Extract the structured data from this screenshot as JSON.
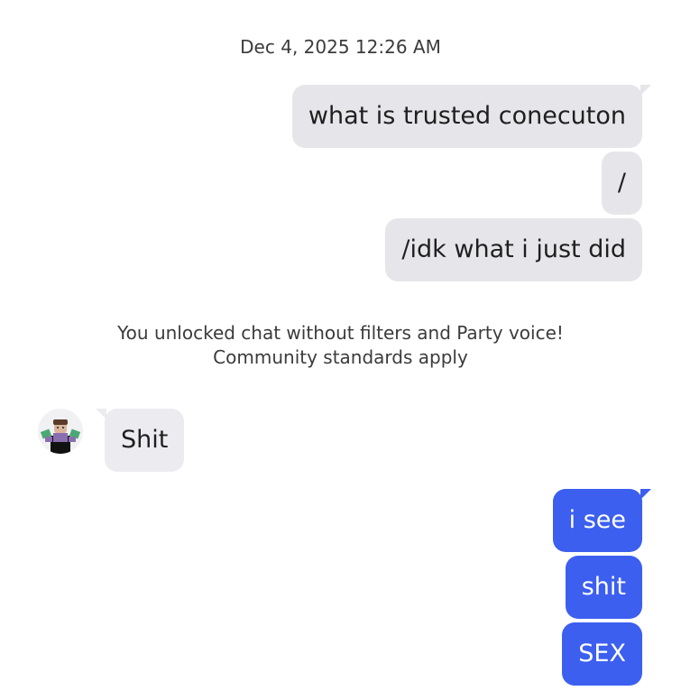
{
  "timestamp": "Dec 4, 2025 12:26 AM",
  "messages_before": [
    {
      "text": "what is trusted conecuton"
    },
    {
      "text": "/"
    },
    {
      "text": "/idk what i just did"
    }
  ],
  "system_notice": {
    "line1": "You unlocked chat without filters and Party voice!",
    "line2": "Community standards apply"
  },
  "incoming": {
    "text": "Shit",
    "avatar_icon": "roblox-avatar-icon"
  },
  "messages_after": [
    {
      "text": "i see"
    },
    {
      "text": "shit"
    },
    {
      "text": "SEX"
    }
  ],
  "colors": {
    "outgoing_grey": "#e6e6ea",
    "outgoing_blue": "#3c5ff0",
    "incoming_grey": "#ececf0",
    "meta_text": "#3b3b3b"
  }
}
